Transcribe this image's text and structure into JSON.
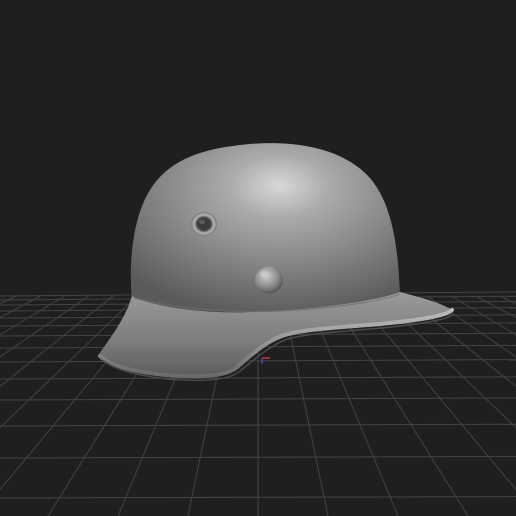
{
  "viewport": {
    "background_color": "#1f1f1f",
    "grid_color": "#4a4a4a"
  },
  "model": {
    "name": "",
    "material_color": "#8c8c8c",
    "highlight_color": "#d6d6d6",
    "shadow_color": "#3c3c3c"
  },
  "axis_gizmo": {
    "x_color": "#c23a3a",
    "y_color": "#3a8c3a",
    "z_color": "#3a4fc2"
  }
}
